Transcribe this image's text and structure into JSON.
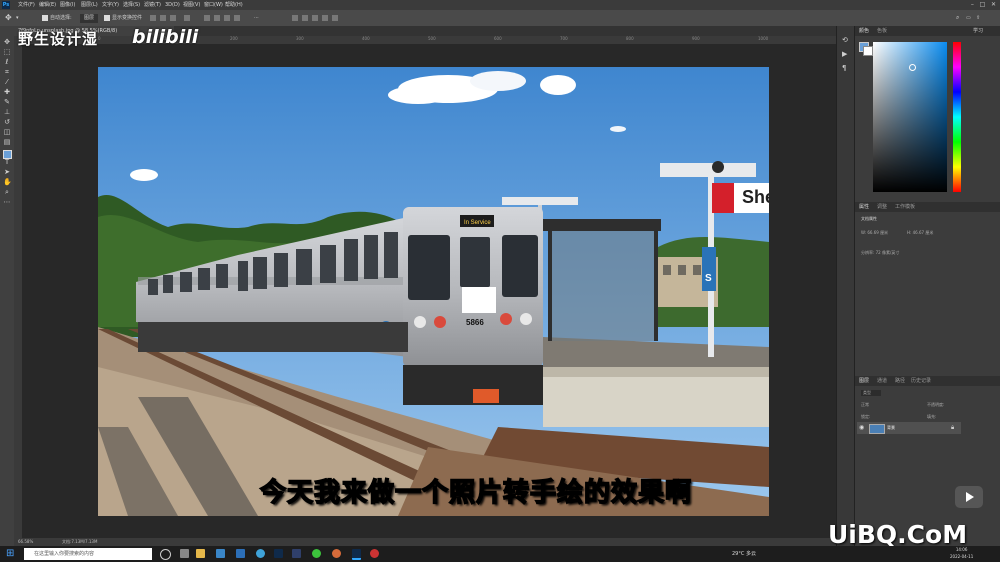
{
  "app": {
    "logo": "Ps",
    "menus": [
      "文件(F)",
      "编辑(E)",
      "图像(I)",
      "图层(L)",
      "文字(Y)",
      "选择(S)",
      "滤镜(T)",
      "3D(D)",
      "视图(V)",
      "窗口(W)",
      "帮助(H)"
    ],
    "window_controls": [
      "–",
      "□",
      "✕"
    ],
    "profile_text": "基本功能"
  },
  "options_bar": {
    "auto_select": "自动选择:",
    "layer_option": "图层",
    "show_transform": "显示变换控件",
    "more": "···"
  },
  "document": {
    "tab_label": "7f9pfoLn-unsplash.jpg @ 58.5%(RGB/8)",
    "ruler_ticks": [
      "0",
      "100",
      "200",
      "300",
      "400",
      "500",
      "600",
      "700",
      "800",
      "900",
      "1000"
    ],
    "zoom": "66.58%",
    "doc_info": "文档:7.13M/7.13M"
  },
  "photo": {
    "train_number": "5866",
    "destination_sign": "In Service",
    "station_sign": "She",
    "colors": {
      "sky_top": "#3f86cf",
      "sky_bottom": "#9dc8ee",
      "train": "#b7b9bd",
      "sign_red": "#d4202b",
      "platform": "#8f8a80"
    }
  },
  "right_panel": {
    "color_tabs": [
      "颜色",
      "色板"
    ],
    "learn": "学习",
    "properties_tabs": [
      "属性",
      "调整",
      "工作模板"
    ],
    "doc_props_title": "文档属性",
    "w_label": "W: 66.69 厘米",
    "h_label": "H: 46.67 厘米",
    "resolution": "分辨率: 72 像素/英寸",
    "layers_tabs": [
      "图层",
      "通道",
      "路径",
      "历史记录"
    ],
    "layers_filter": "类型",
    "blend_mode": "正常",
    "opacity": "不透明度:",
    "lock": "锁定:",
    "fill": "填充:",
    "layer_name": "背景"
  },
  "overlay": {
    "channel_name": "野生设计湿",
    "bili_logo": "bilibili",
    "subtitle": "今天我来做一个照片转手绘的效果啊",
    "watermark": "UiBQ.CoM"
  },
  "taskbar": {
    "search_placeholder": "在这里输入你要搜索的内容",
    "weather": "29°C 多云",
    "time": "14:06",
    "date": "2022-04-11"
  }
}
